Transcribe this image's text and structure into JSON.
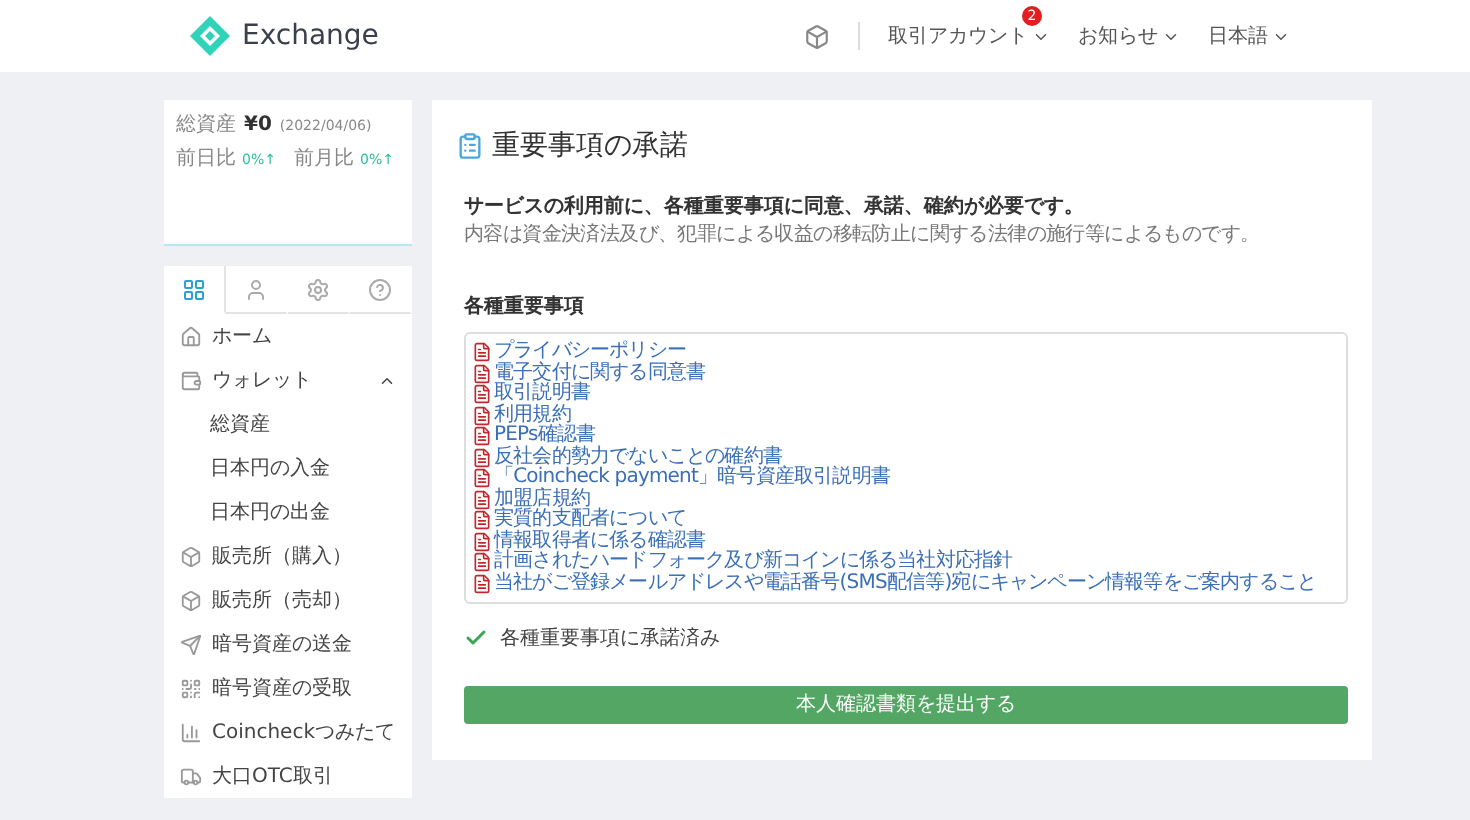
{
  "header": {
    "logo_text": "Exchange",
    "nav": [
      {
        "label": "取引アカウント",
        "badge": "2"
      },
      {
        "label": "お知らせ"
      },
      {
        "label": "日本語"
      }
    ]
  },
  "sidebar": {
    "balance": {
      "label": "総資産",
      "value": "¥0",
      "date": "(2022/04/06)"
    },
    "changes": [
      {
        "label": "前日比",
        "value": "0%↑"
      },
      {
        "label": "前月比",
        "value": "0%↑"
      }
    ],
    "tabs": [
      {
        "selected": true
      },
      {
        "selected": false
      },
      {
        "selected": false
      },
      {
        "selected": false
      }
    ],
    "items": [
      {
        "kind": "main",
        "label": "ホーム"
      },
      {
        "kind": "main",
        "label": "ウォレット",
        "expanded": true
      },
      {
        "kind": "sub",
        "label": "総資産"
      },
      {
        "kind": "sub",
        "label": "日本円の入金"
      },
      {
        "kind": "sub",
        "label": "日本円の出金"
      },
      {
        "kind": "main",
        "label": "販売所（購入）"
      },
      {
        "kind": "main",
        "label": "販売所（売却）"
      },
      {
        "kind": "main",
        "label": "暗号資産の送金"
      },
      {
        "kind": "main",
        "label": "暗号資産の受取"
      },
      {
        "kind": "main",
        "label": "Coincheckつみたて"
      },
      {
        "kind": "main",
        "label": "大口OTC取引"
      }
    ]
  },
  "main": {
    "title": "重要事項の承諾",
    "intro_bold": "サービスの利用前に、各種重要事項に同意、承諾、確約が必要です。",
    "intro": "内容は資金決済法及び、犯罪による収益の移転防止に関する法律の施行等によるものです。",
    "section_label": "各種重要事項",
    "documents": [
      "プライバシーポリシー",
      "電子交付に関する同意書",
      "取引説明書",
      "利用規約",
      "PEPs確認書",
      "反社会的勢力でないことの確約書",
      "「Coincheck payment」暗号資産取引説明書",
      "加盟店規約",
      "実質的支配者について",
      "情報取得者に係る確認書",
      "計画されたハードフォーク及び新コインに係る当社対応指針",
      "当社がご登録メールアドレスや電話番号(SMS配信等)宛にキャンペーン情報等をご案内すること"
    ],
    "confirmation": {
      "text": "各種重要事項に承諾済み",
      "checked": true
    },
    "submit_button": "本人確認書類を提出する"
  }
}
